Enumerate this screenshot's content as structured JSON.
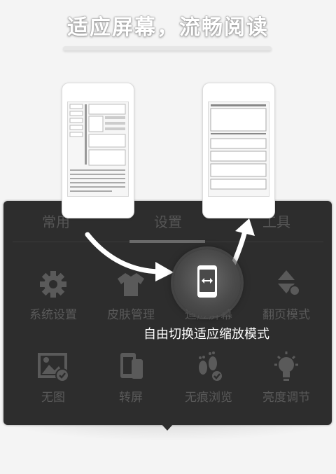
{
  "headline": "适应屏幕，流畅阅读",
  "tabs": [
    {
      "label": "常用"
    },
    {
      "label": "设置"
    },
    {
      "label": "工具"
    }
  ],
  "grid": [
    {
      "label": "系统设置",
      "icon": "gear-icon"
    },
    {
      "label": "皮肤管理",
      "icon": "shirt-icon"
    },
    {
      "label": "适应屏幕",
      "icon": "fit-screen-icon"
    },
    {
      "label": "翻页模式",
      "icon": "page-turn-icon"
    },
    {
      "label": "无图",
      "icon": "no-image-icon"
    },
    {
      "label": "转屏",
      "icon": "rotate-screen-icon"
    },
    {
      "label": "无痕浏览",
      "icon": "footprints-icon"
    },
    {
      "label": "亮度调节",
      "icon": "bulb-icon"
    }
  ],
  "hero": {
    "caption": "自由切换适应缩放模式",
    "icon": "fit-screen-icon"
  },
  "colors": {
    "panel": "#2d2d2d",
    "dim_text": "#5a5a5a",
    "accent": "#ffffff"
  }
}
